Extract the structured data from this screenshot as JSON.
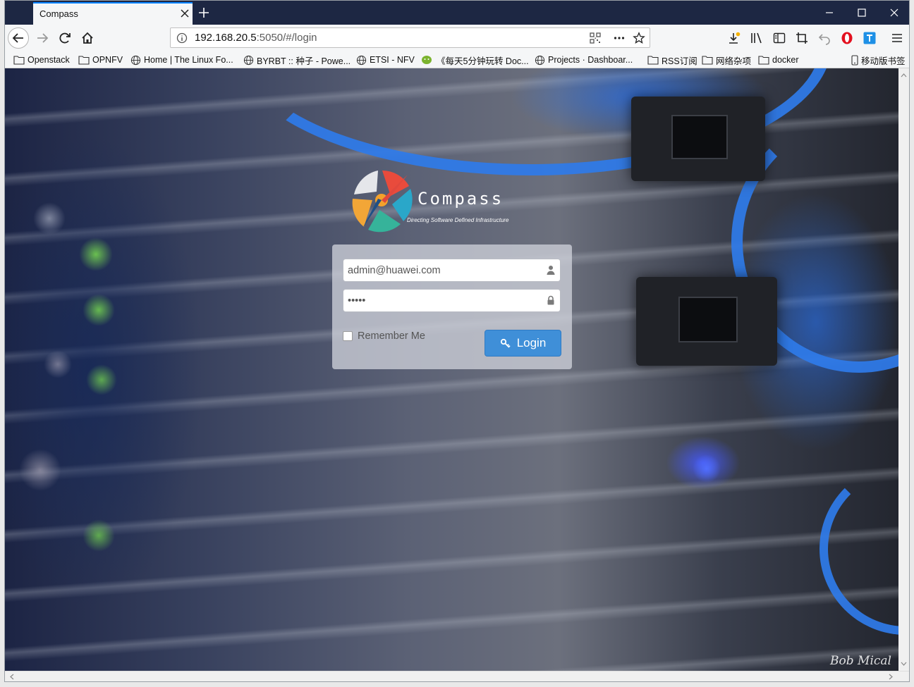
{
  "browser": {
    "tab_title": "Compass",
    "url_host": "192.168.20.5",
    "url_rest": ":5050/#/login"
  },
  "bookmarks": [
    {
      "label": "Openstack",
      "icon": "folder-icon"
    },
    {
      "label": "OPNFV",
      "icon": "folder-icon"
    },
    {
      "label": "Home | The Linux Fo...",
      "icon": "globe-icon"
    },
    {
      "label": "BYRBT :: 种子 - Powe...",
      "icon": "globe-icon"
    },
    {
      "label": "ETSI - NFV",
      "icon": "globe-icon"
    },
    {
      "label": "《每天5分钟玩转 Doc...",
      "icon": "wechat-icon"
    },
    {
      "label": "Projects · Dashboar...",
      "icon": "globe-icon"
    },
    {
      "label": "RSS订阅",
      "icon": "folder-icon"
    },
    {
      "label": "网络杂项",
      "icon": "folder-icon"
    },
    {
      "label": "docker",
      "icon": "folder-icon"
    },
    {
      "label": "移动版书签",
      "icon": "mobile-icon"
    }
  ],
  "logo": {
    "name": "Compass",
    "tagline": "Directing Software Defined Infrastructure"
  },
  "login": {
    "email_value": "admin@huawei.com",
    "password_value": "12345",
    "remember_label": "Remember Me",
    "remember_checked": false,
    "button_label": "Login"
  },
  "watermark": "Bob Mical",
  "colors": {
    "tabstrip": "#1d2743",
    "login_button": "#3f8fd8",
    "active_tab_accent": "#0a84ff"
  }
}
